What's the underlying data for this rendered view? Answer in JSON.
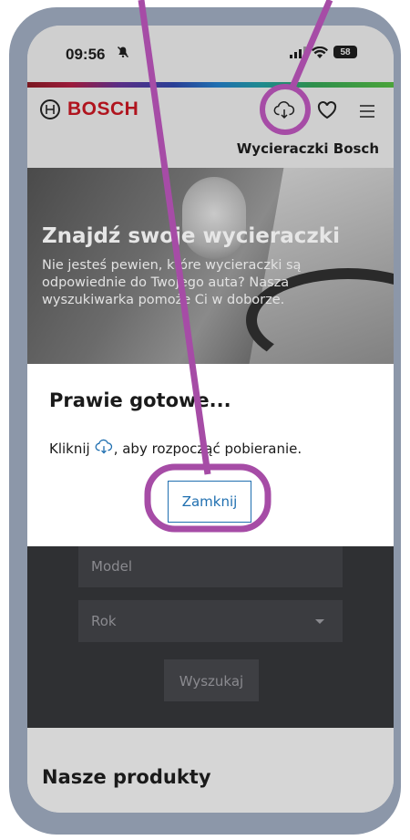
{
  "status_bar": {
    "time": "09:56",
    "battery": "58",
    "bell_icon": "bell-slash-icon",
    "signal_icon": "signal-bars-icon",
    "wifi_icon": "wifi-icon"
  },
  "header": {
    "brand": "BOSCH",
    "brand_color": "#b0141e",
    "subtitle": "Wycieraczki Bosch",
    "icons": {
      "download": "cloud-download-icon",
      "favorites": "heart-icon",
      "menu": "hamburger-menu-icon"
    }
  },
  "hero": {
    "title": "Znajdź swoje wycieraczki",
    "description": "Nie jesteś pewien, które wycieraczki są odpowiednie do Twojego auta? Nasza wyszukiwarka pomoże Ci w doborze."
  },
  "form": {
    "model_placeholder": "Model",
    "year_placeholder": "Rok",
    "search_label": "Wyszukaj"
  },
  "products": {
    "heading": "Nasze produkty"
  },
  "modal": {
    "title": "Prawie gotowe...",
    "message_before": "Kliknij",
    "message_after": ", aby rozpocząć pobieranie.",
    "close_label": "Zamknij",
    "accent_color": "#1f6fb0"
  },
  "annotation": {
    "color": "#a64ca6"
  }
}
